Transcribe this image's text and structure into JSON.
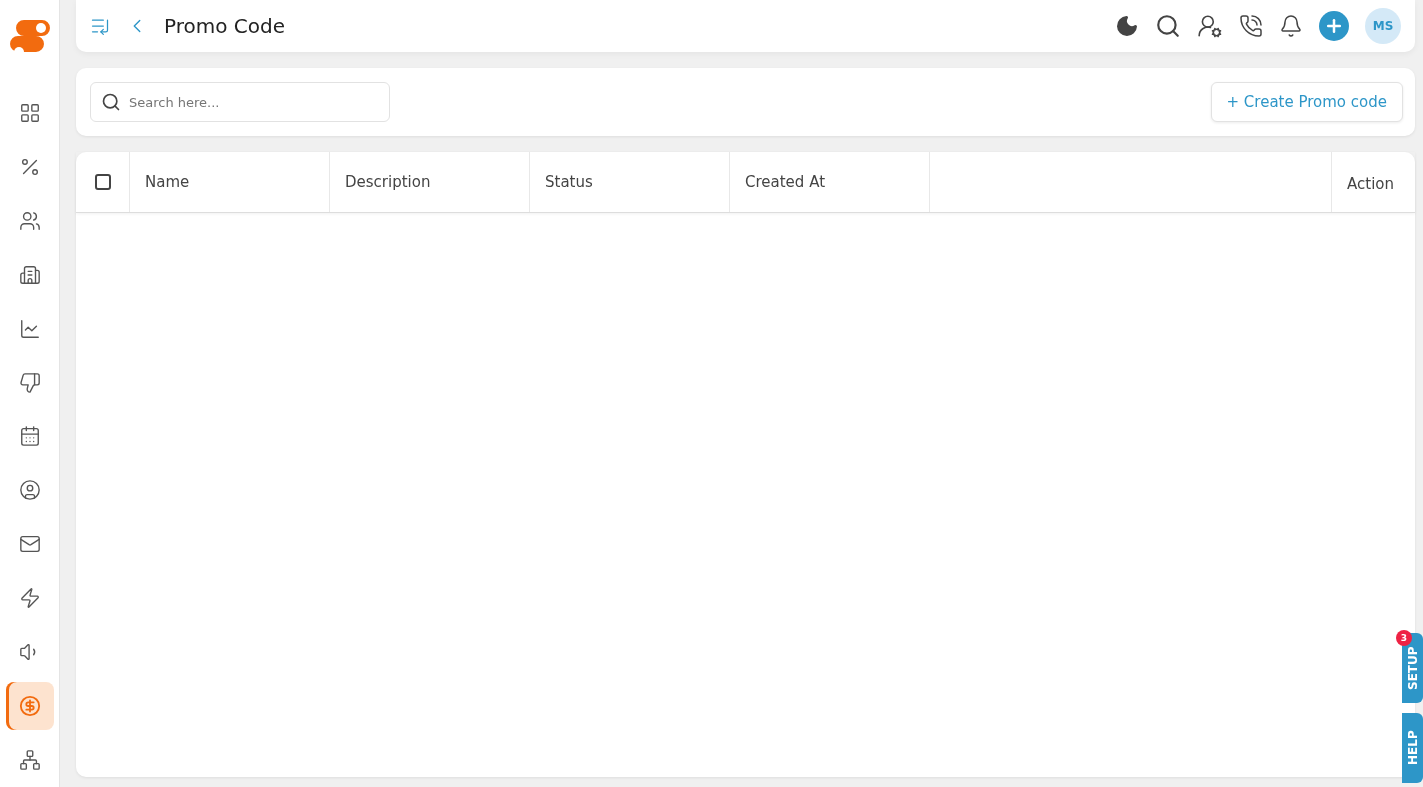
{
  "sidebar": {
    "items": [
      {
        "selected": false
      },
      {
        "selected": false
      },
      {
        "selected": false
      },
      {
        "selected": false
      },
      {
        "selected": false
      },
      {
        "selected": false
      },
      {
        "selected": false
      },
      {
        "selected": false
      },
      {
        "selected": false
      },
      {
        "selected": false
      },
      {
        "selected": false
      },
      {
        "selected": true
      },
      {
        "selected": false
      }
    ]
  },
  "header": {
    "title": "Promo Code",
    "avatar": "MS"
  },
  "toolbar": {
    "search": {
      "placeholder": "Search here..."
    },
    "create_button": "+ Create Promo code"
  },
  "table": {
    "select_all": {
      "checked": false
    },
    "columns": [
      "Name",
      "Description",
      "Status",
      "Created At"
    ],
    "action_column": "Action"
  },
  "side_tabs": [
    {
      "label": "SETUP",
      "badge": "3"
    },
    {
      "label": "HELP"
    }
  ]
}
